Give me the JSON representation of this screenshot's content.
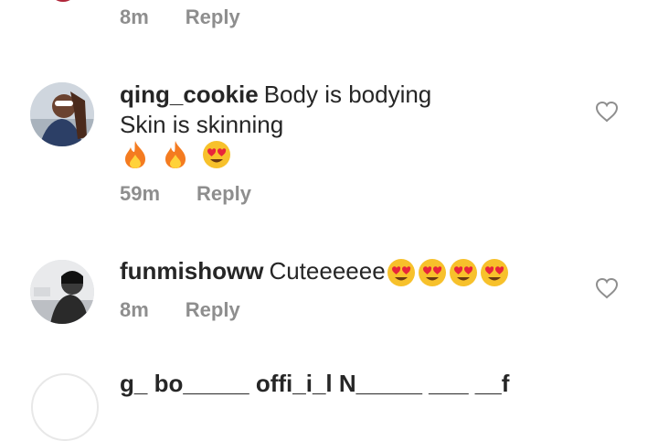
{
  "prev_comment": {
    "time": "8m",
    "reply": "Reply"
  },
  "comments": [
    {
      "username": "qing_cookie",
      "lines": [
        "Body is bodying",
        "Skin is skinning"
      ],
      "emojis": [
        "fire-emoji",
        "fire-emoji",
        "heart-eyes-emoji"
      ],
      "time": "59m",
      "reply": "Reply"
    },
    {
      "username": "funmishoww",
      "text": "Cuteeeeee",
      "emojis": [
        "heart-eyes-emoji",
        "heart-eyes-emoji",
        "heart-eyes-emoji",
        "heart-eyes-emoji"
      ],
      "time": "8m",
      "reply": "Reply"
    }
  ],
  "next_comment": {
    "text_partial": "g_ bo_____ offi_i_l N_____ ___ __f"
  },
  "colors": {
    "text": "#262626",
    "muted": "#8e8e8e",
    "heart_eyes": "#e8253a",
    "emoji_face": "#f7c12b",
    "fire": "#f47b20"
  }
}
